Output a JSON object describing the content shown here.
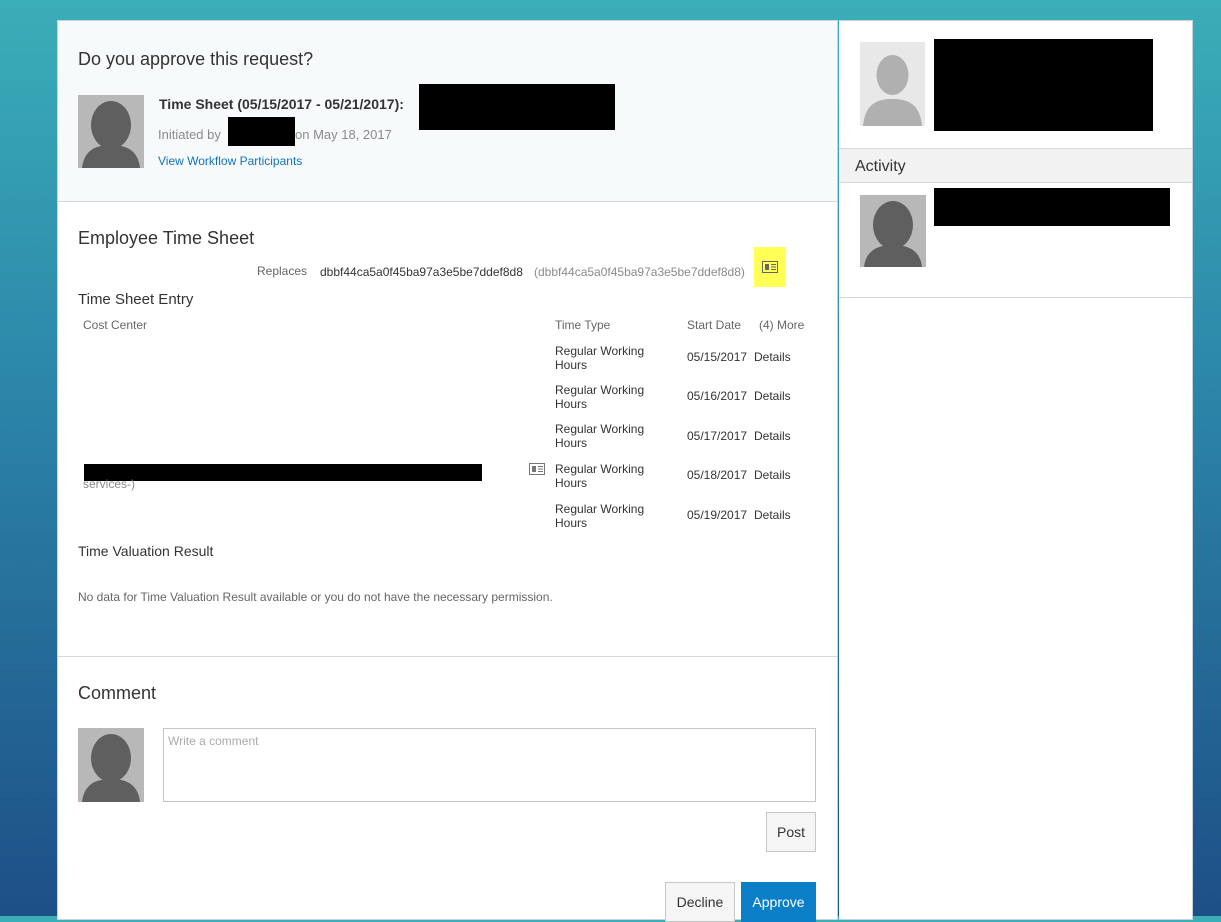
{
  "request": {
    "question": "Do you approve this request?",
    "title": "Time Sheet (05/15/2017 - 05/21/2017):",
    "initiated_prefix": "Initiated by",
    "initiated_suffix": "on May 18, 2017",
    "workflow_link": "View Workflow Participants"
  },
  "timesheet": {
    "section_title": "Employee Time Sheet",
    "replaces_label": "Replaces",
    "replaces_value": "dbbf44ca5a0f45ba97a3e5be7ddef8d8",
    "replaces_paren": "(dbbf44ca5a0f45ba97a3e5be7ddef8d8)",
    "entry_title": "Time Sheet Entry",
    "columns": {
      "cost_center": "Cost Center",
      "time_type": "Time Type",
      "start_date": "Start Date",
      "more": "(4) More"
    },
    "cost_center_partial": "services-)",
    "rows": [
      {
        "time_type": "Regular Working Hours",
        "start_date": "05/15/2017",
        "details": "Details"
      },
      {
        "time_type": "Regular Working Hours",
        "start_date": "05/16/2017",
        "details": "Details"
      },
      {
        "time_type": "Regular Working Hours",
        "start_date": "05/17/2017",
        "details": "Details"
      },
      {
        "time_type": "Regular Working Hours",
        "start_date": "05/18/2017",
        "details": "Details"
      },
      {
        "time_type": "Regular Working Hours",
        "start_date": "05/19/2017",
        "details": "Details"
      }
    ],
    "valuation_title": "Time Valuation Result",
    "valuation_message": "No data for Time Valuation Result available or you do not have the necessary permission."
  },
  "comment": {
    "title": "Comment",
    "placeholder": "Write a comment",
    "post_label": "Post"
  },
  "actions": {
    "decline_label": "Decline",
    "approve_label": "Approve"
  },
  "sidebar": {
    "activity_label": "Activity"
  },
  "colors": {
    "link": "#1273b8",
    "primary": "#0a7fc8",
    "highlight": "#ffff55"
  }
}
